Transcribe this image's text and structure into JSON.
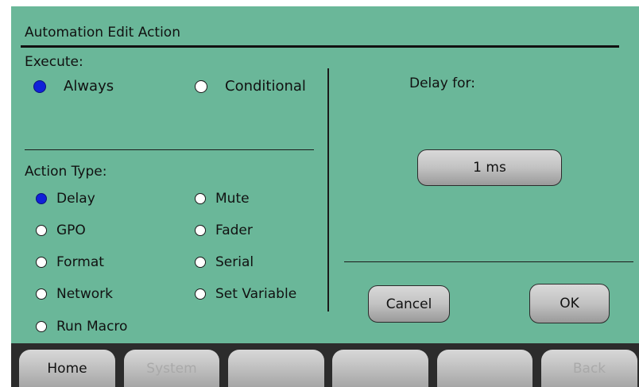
{
  "title": "Automation Edit Action",
  "execute": {
    "label": "Execute:",
    "options": [
      {
        "label": "Always",
        "selected": true
      },
      {
        "label": "Conditional",
        "selected": false
      }
    ]
  },
  "action_type": {
    "label": "Action Type:",
    "options": [
      {
        "label": "Delay",
        "selected": true
      },
      {
        "label": "Mute",
        "selected": false
      },
      {
        "label": "GPO",
        "selected": false
      },
      {
        "label": "Fader",
        "selected": false
      },
      {
        "label": "Format",
        "selected": false
      },
      {
        "label": "Serial",
        "selected": false
      },
      {
        "label": "Network",
        "selected": false
      },
      {
        "label": "Set Variable",
        "selected": false
      },
      {
        "label": "Run Macro",
        "selected": false
      }
    ]
  },
  "delay": {
    "label": "Delay for:",
    "value": "1 ms"
  },
  "buttons": {
    "cancel": "Cancel",
    "ok": "OK"
  },
  "nav": [
    {
      "label": "Home",
      "enabled": true
    },
    {
      "label": "System",
      "enabled": false
    },
    {
      "label": "",
      "enabled": true
    },
    {
      "label": "",
      "enabled": true
    },
    {
      "label": "",
      "enabled": true
    },
    {
      "label": "Back",
      "enabled": false
    }
  ],
  "colors": {
    "background": "#6ab799",
    "selected_radio": "#1020d8",
    "nav_bar": "#2c2c2c"
  }
}
